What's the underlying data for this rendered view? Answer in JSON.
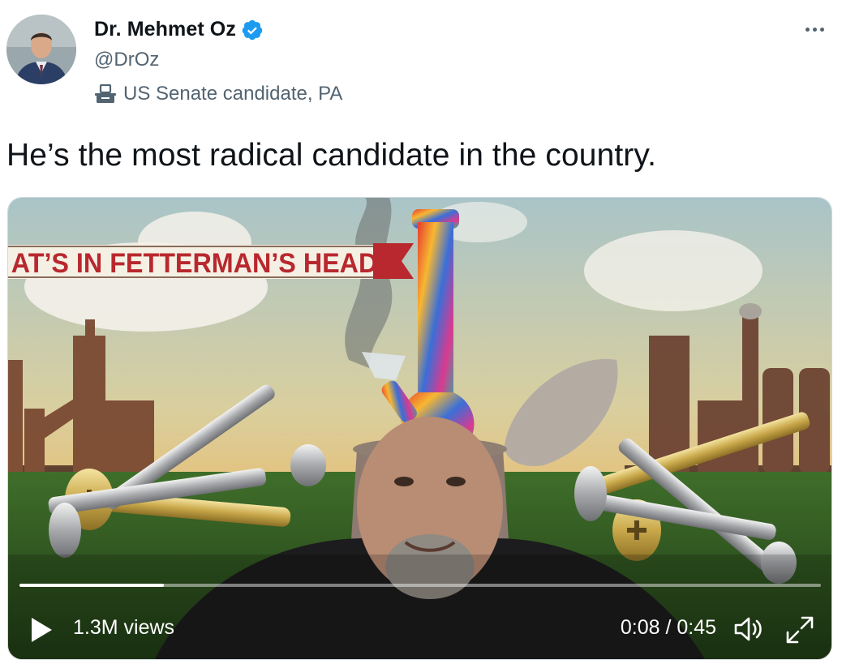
{
  "tweet": {
    "author": {
      "display_name": "Dr. Mehmet Oz",
      "handle": "@DrOz",
      "label": "US Senate candidate, PA",
      "avatar_icon": "avatar-photo",
      "verified_icon": "verified-badge-icon",
      "label_icon": "ballot-box-icon"
    },
    "text": "He’s the most radical candidate in the country.",
    "more_icon": "more-options-icon"
  },
  "video": {
    "banner_text": "AT’S IN FETTERMAN’S HEAD",
    "views": "1.3M views",
    "time": "0:08 / 0:45",
    "progress_fraction": 0.18,
    "icons": {
      "play": "play-icon",
      "volume": "volume-icon",
      "fullscreen": "fullscreen-icon"
    }
  },
  "colors": {
    "verified": "#1d9bf0",
    "secondary_text": "#536471",
    "primary_text": "#0f1419",
    "banner_red": "#b8282e"
  }
}
